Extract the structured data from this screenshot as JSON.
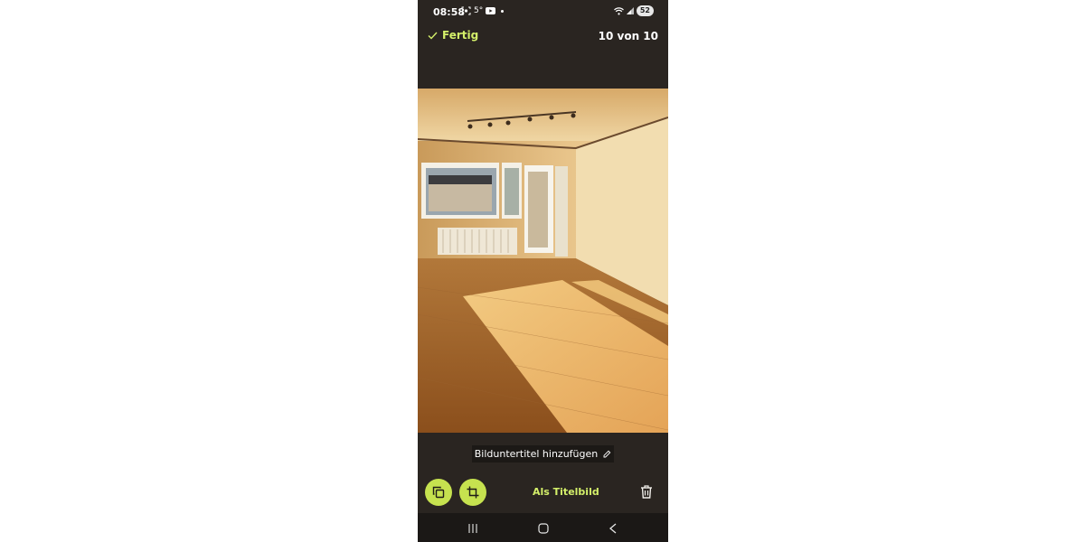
{
  "status_bar": {
    "time": "08:58",
    "temperature": "5°",
    "battery": "52",
    "icons": [
      "screenshot-icon",
      "youtube-icon",
      "dot-icon",
      "wifi-icon",
      "signal-icon",
      "battery-icon"
    ]
  },
  "top_bar": {
    "done_label": "Fertig",
    "counter": "10 von 10"
  },
  "photo": {
    "description_icon": "apartment-room-photo"
  },
  "caption": {
    "label": "Bilduntertitel hinzufügen"
  },
  "actions": {
    "copy_icon": "copy-icon",
    "crop_icon": "crop-icon",
    "set_cover_label": "Als Titelbild",
    "delete_icon": "trash-icon"
  },
  "colors": {
    "background": "#2a2521",
    "accent": "#d4f06a",
    "button_fill": "#c6e24f"
  }
}
